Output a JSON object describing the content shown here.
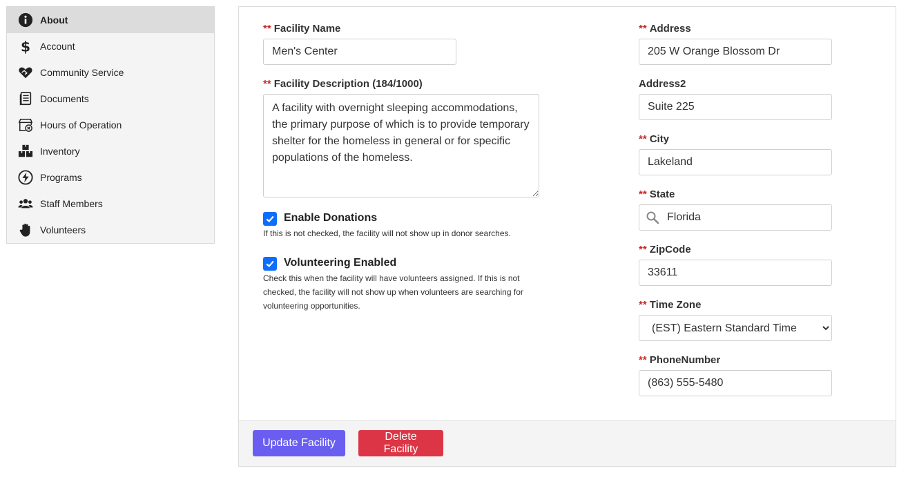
{
  "sidebar": {
    "items": [
      {
        "label": "About",
        "icon": "info-icon",
        "active": true
      },
      {
        "label": "Account",
        "icon": "dollar-icon"
      },
      {
        "label": "Community Service",
        "icon": "handshake-heart-icon"
      },
      {
        "label": "Documents",
        "icon": "document-icon"
      },
      {
        "label": "Hours of Operation",
        "icon": "store-clock-icon"
      },
      {
        "label": "Inventory",
        "icon": "boxes-icon"
      },
      {
        "label": "Programs",
        "icon": "bolt-icon"
      },
      {
        "label": "Staff Members",
        "icon": "users-icon"
      },
      {
        "label": "Volunteers",
        "icon": "hand-icon"
      }
    ]
  },
  "form": {
    "required_marker": "**",
    "facility_name": {
      "label": "Facility Name",
      "value": "Men's Center"
    },
    "facility_description": {
      "label": "Facility Description (184/1000)",
      "value": "A facility with overnight sleeping accommodations, the primary purpose of which is to provide temporary shelter for the homeless in general or for specific populations of the homeless."
    },
    "enable_donations": {
      "label": "Enable Donations",
      "checked": true,
      "help": "If this is not checked, the facility will not show up in donor searches."
    },
    "volunteering_enabled": {
      "label": "Volunteering Enabled",
      "checked": true,
      "help": "Check this when the facility will have volunteers assigned. If this is not checked, the facility will not show up when volunteers are searching for volunteering opportunities."
    },
    "address": {
      "label": "Address",
      "value": "205 W Orange Blossom Dr"
    },
    "address2": {
      "label": "Address2",
      "value": "Suite 225"
    },
    "city": {
      "label": "City",
      "value": "Lakeland"
    },
    "state": {
      "label": "State",
      "value": "Florida",
      "icon": "search-icon"
    },
    "zipcode": {
      "label": "ZipCode",
      "value": "33611"
    },
    "time_zone": {
      "label": "Time Zone",
      "value": "(EST) Eastern Standard Time"
    },
    "phone": {
      "label": "PhoneNumber",
      "value": "(863) 555-5480"
    }
  },
  "footer": {
    "update_label": "Update Facility",
    "delete_label": "Delete Facility"
  },
  "colors": {
    "primary": "#6a5ef1",
    "danger": "#dc3545",
    "checkbox": "#0d6efd",
    "required": "#c62828"
  }
}
